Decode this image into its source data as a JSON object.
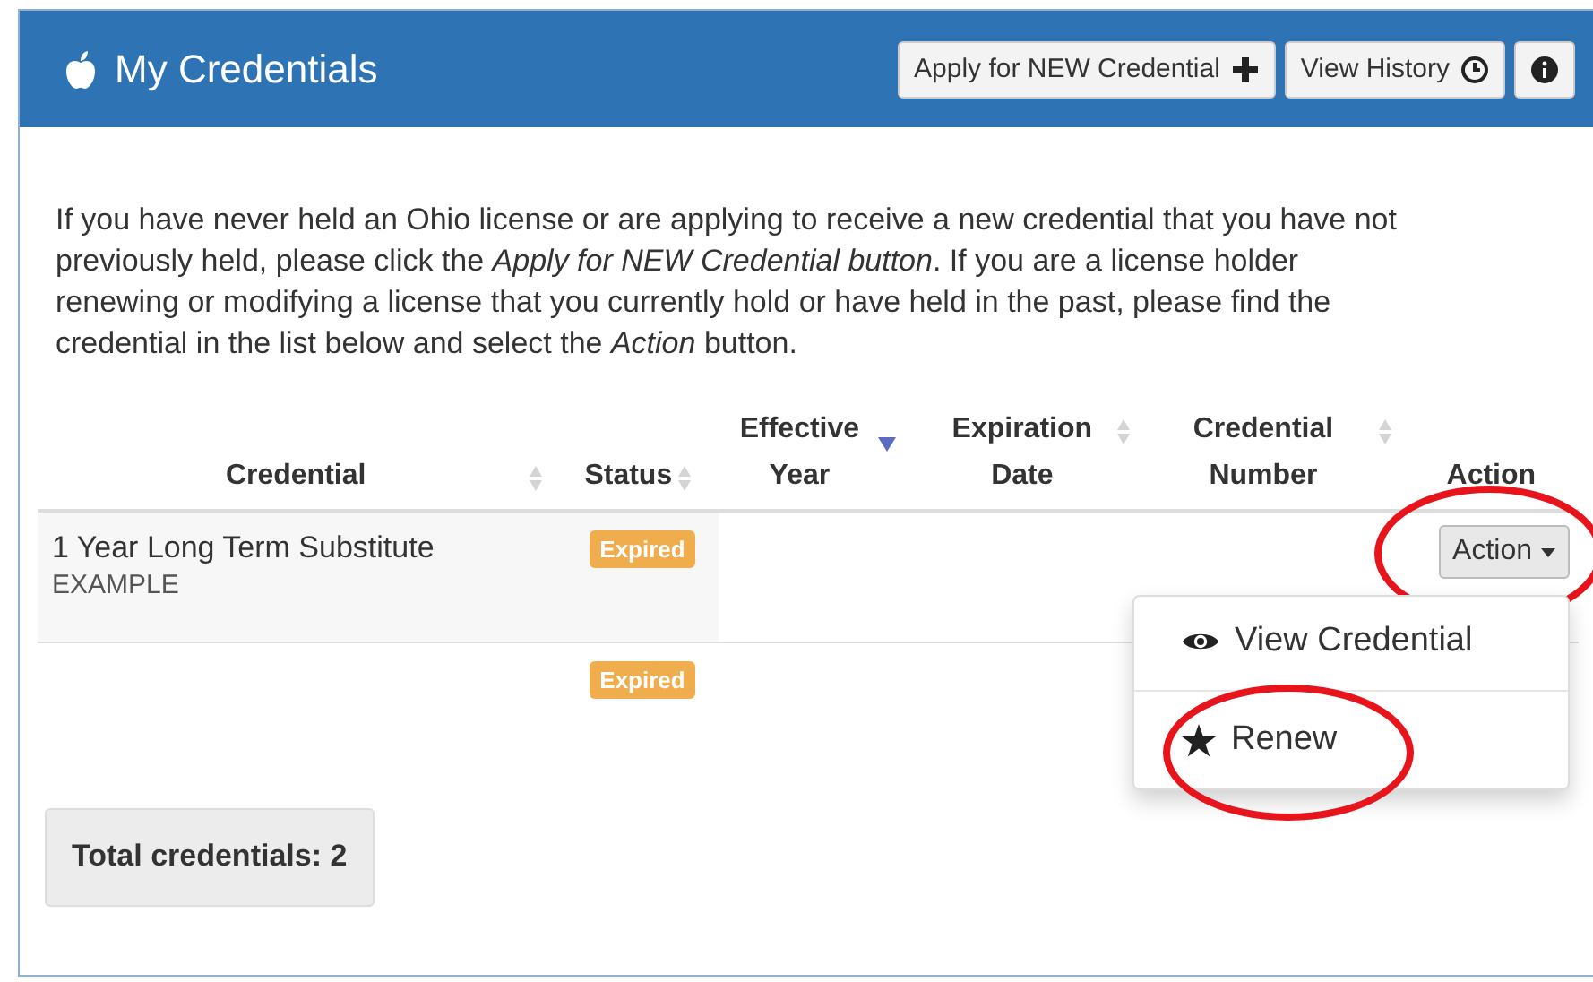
{
  "panel": {
    "title": "My Credentials",
    "buttons": [
      {
        "label": "Apply for NEW Credential",
        "kind": "add"
      },
      {
        "label": "View History",
        "kind": "history"
      },
      {
        "kind": "info"
      }
    ]
  },
  "intro": "If you have never held an Ohio license or are applying to receive a new credential that you have not previously held, please click the *Apply for NEW Credential button*. If you are a license holder renewing or modifying a license that you currently hold or have held in the past, please find the credential in the list below and select the *Action* button.",
  "table": {
    "columns": [
      {
        "label": "Credential",
        "sortable": true,
        "sorted": false
      },
      {
        "label": "Status",
        "sortable": true,
        "sorted": false
      },
      {
        "label": "Effective Year",
        "sortable": true,
        "sorted": true
      },
      {
        "label": "Expiration Date",
        "sortable": true,
        "sorted": false
      },
      {
        "label": "Credential Number",
        "sortable": true,
        "sorted": false
      },
      {
        "label": "Action",
        "sortable": false,
        "sorted": false
      }
    ],
    "rows": [
      {
        "credential": "1 Year Long Term Substitute",
        "subtitle": "EXAMPLE",
        "status": "Expired",
        "action": {
          "label": "Action",
          "circled": true
        }
      },
      {
        "status": "Expired"
      }
    ]
  },
  "dropdown": {
    "expanded": true,
    "items": [
      {
        "label": "View Credential",
        "circled": false
      },
      {
        "label": "Renew",
        "circled": true
      }
    ]
  },
  "footer": "Total credentials: 2"
}
